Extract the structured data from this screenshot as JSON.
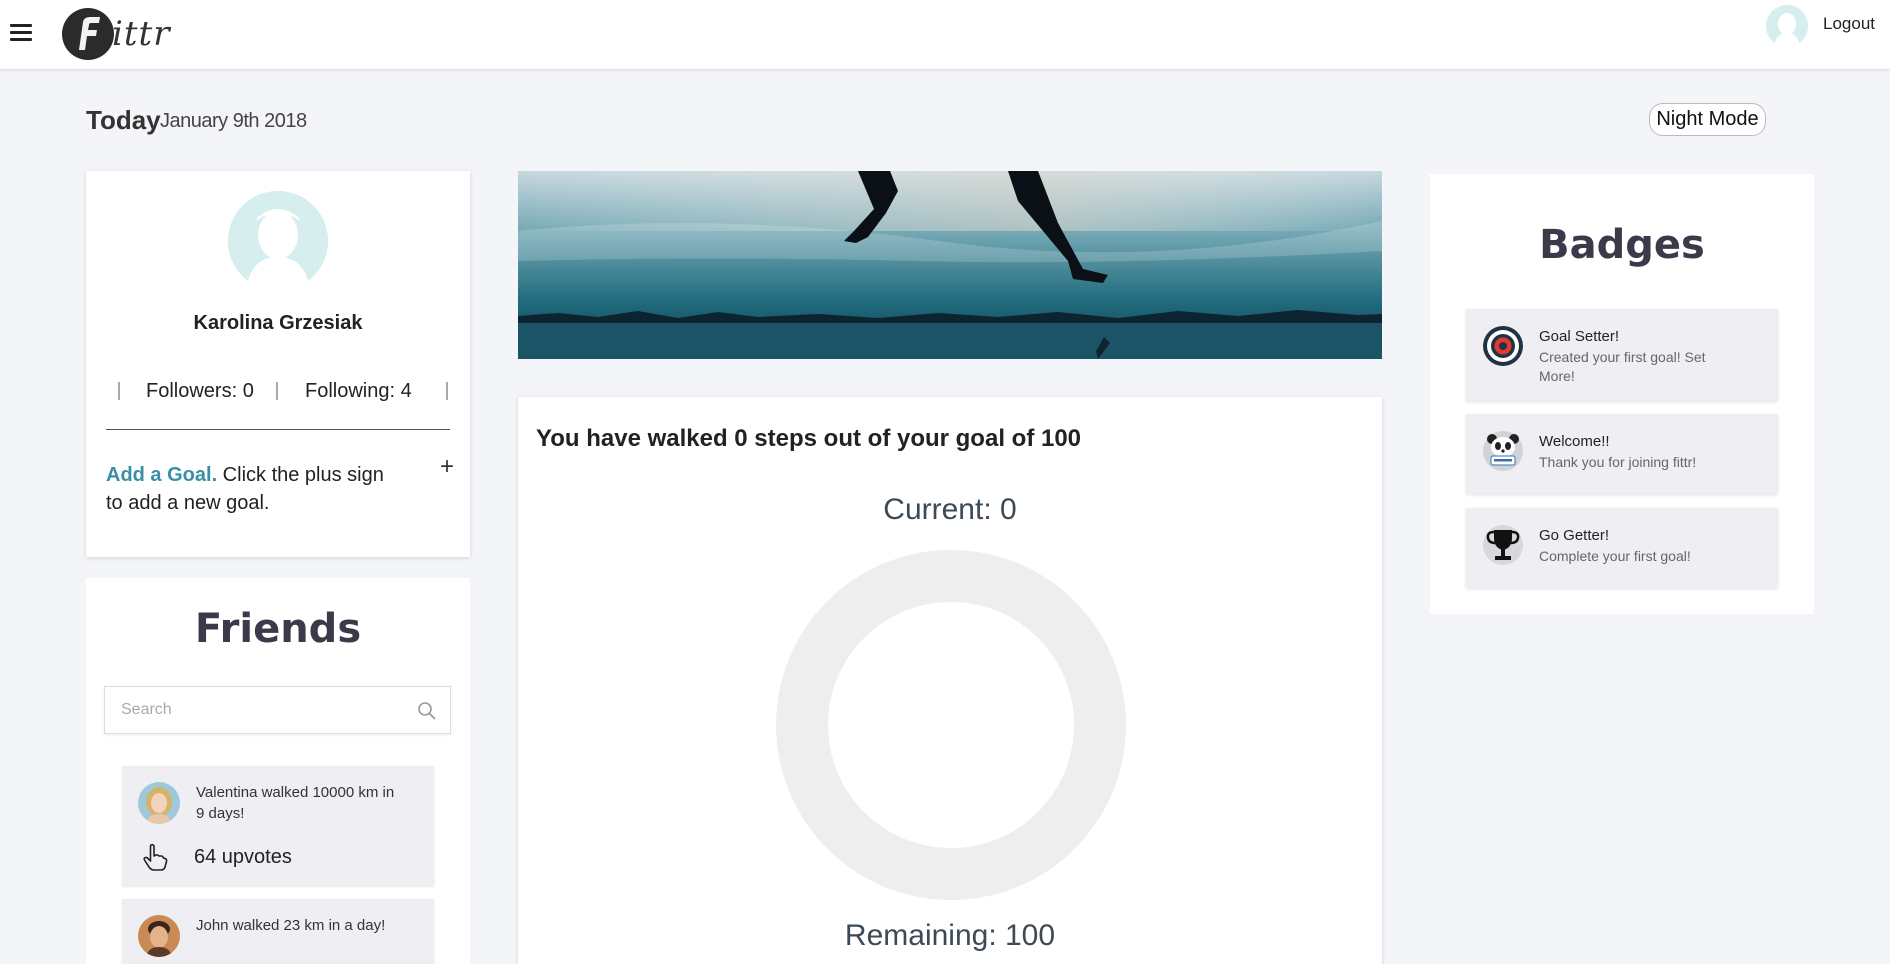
{
  "header": {
    "logo_text": "ittr",
    "logout_label": "Logout"
  },
  "date_row": {
    "today_label": "Today",
    "date": "January 9th 2018",
    "night_mode_label": "Night Mode"
  },
  "profile": {
    "name": "Karolina Grzesiak",
    "followers": "Followers: 0",
    "following": "Following: 4",
    "add_goal_link": "Add a Goal.",
    "add_goal_text": " Click the plus sign to add a new goal.",
    "plus": "+"
  },
  "friends": {
    "title": "Friends",
    "search_placeholder": "Search",
    "feed": [
      {
        "text": "Valentina walked 10000 km in 9 days!",
        "upvotes": "64 upvotes"
      },
      {
        "text": "John walked 23 km in a day!"
      }
    ]
  },
  "steps": {
    "title": "You have walked 0 steps out of your goal of 100",
    "current": "Current: 0",
    "remaining": "Remaining: 100",
    "progress": 0
  },
  "badges": {
    "title": "Badges",
    "items": [
      {
        "title": "Goal Setter!",
        "desc": "Created your first goal! Set More!",
        "icon": "target-icon"
      },
      {
        "title": "Welcome!!",
        "desc": "Thank you for joining fittr!",
        "icon": "panda-welcome-icon"
      },
      {
        "title": "Go Getter!",
        "desc": "Complete your first goal!",
        "icon": "trophy-icon"
      }
    ]
  },
  "colors": {
    "accent": "#3a8fa8",
    "avatar_bg": "#d6eeee",
    "ring": "#eeeeee"
  }
}
